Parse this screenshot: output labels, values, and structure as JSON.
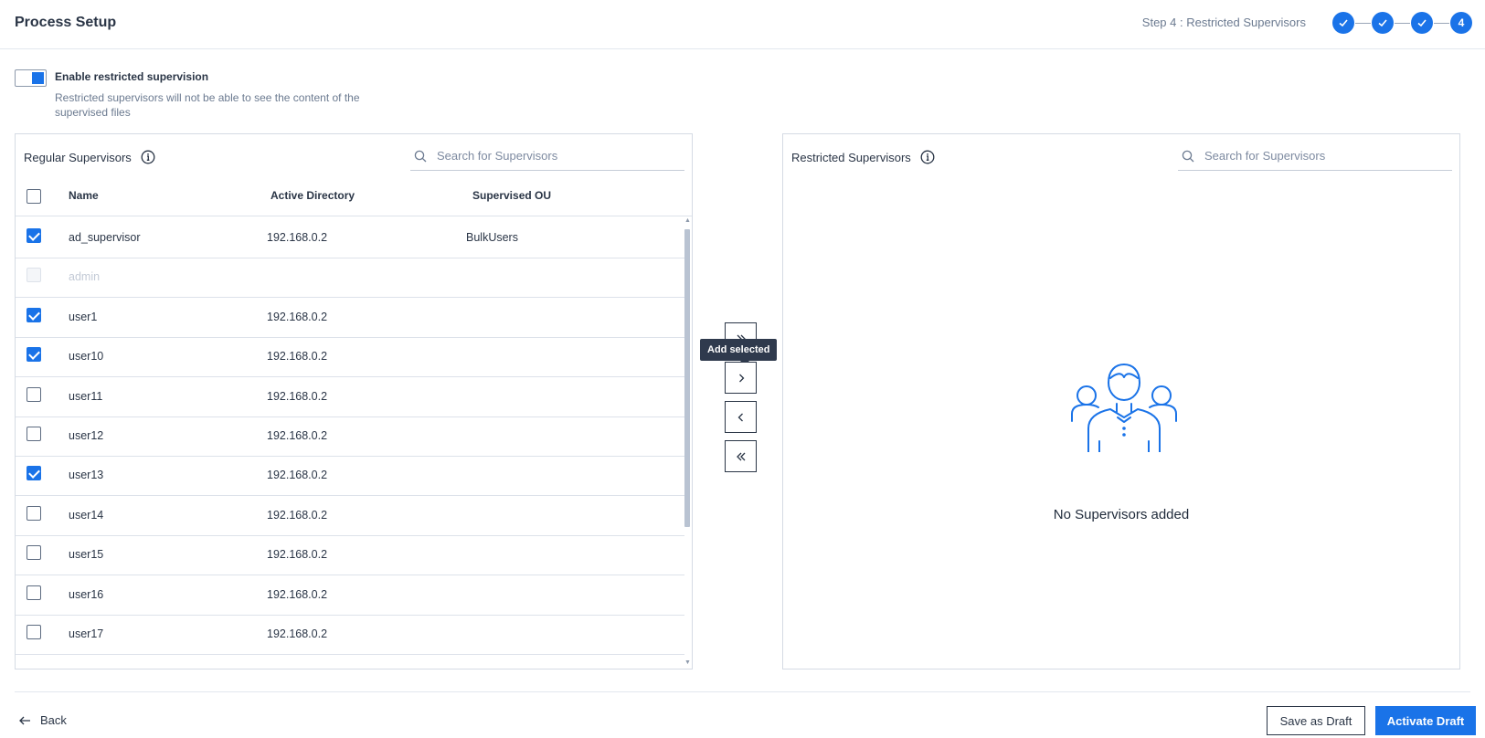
{
  "header": {
    "title": "Process Setup",
    "step_label": "Step 4 : Restricted Supervisors",
    "steps": [
      {
        "state": "done",
        "label": ""
      },
      {
        "state": "done",
        "label": ""
      },
      {
        "state": "done",
        "label": ""
      },
      {
        "state": "current",
        "label": "4"
      }
    ]
  },
  "restriction": {
    "enabled": true,
    "title": "Enable restricted supervision",
    "description": "Restricted supervisors will not be able to see the content of the supervised files"
  },
  "regular_panel": {
    "title": "Regular Supervisors",
    "search_placeholder": "Search for Supervisors",
    "columns": [
      "Name",
      "Active Directory",
      "Supervised OU"
    ],
    "select_all_checked": false,
    "rows": [
      {
        "name": "ad_supervisor",
        "directory": "192.168.0.2",
        "ou": "BulkUsers",
        "checked": true,
        "disabled": false
      },
      {
        "name": "admin",
        "directory": "",
        "ou": "",
        "checked": false,
        "disabled": true
      },
      {
        "name": "user1",
        "directory": "192.168.0.2",
        "ou": "",
        "checked": true,
        "disabled": false
      },
      {
        "name": "user10",
        "directory": "192.168.0.2",
        "ou": "",
        "checked": true,
        "disabled": false
      },
      {
        "name": "user11",
        "directory": "192.168.0.2",
        "ou": "",
        "checked": false,
        "disabled": false
      },
      {
        "name": "user12",
        "directory": "192.168.0.2",
        "ou": "",
        "checked": false,
        "disabled": false
      },
      {
        "name": "user13",
        "directory": "192.168.0.2",
        "ou": "",
        "checked": true,
        "disabled": false
      },
      {
        "name": "user14",
        "directory": "192.168.0.2",
        "ou": "",
        "checked": false,
        "disabled": false
      },
      {
        "name": "user15",
        "directory": "192.168.0.2",
        "ou": "",
        "checked": false,
        "disabled": false
      },
      {
        "name": "user16",
        "directory": "192.168.0.2",
        "ou": "",
        "checked": false,
        "disabled": false
      },
      {
        "name": "user17",
        "directory": "192.168.0.2",
        "ou": "",
        "checked": false,
        "disabled": false
      }
    ]
  },
  "transfer": {
    "tooltip": "Add selected",
    "buttons": [
      {
        "name": "add-all-button",
        "icon": "double-chevron-right-icon"
      },
      {
        "name": "add-selected-button",
        "icon": "chevron-right-icon"
      },
      {
        "name": "remove-selected-button",
        "icon": "chevron-left-icon"
      },
      {
        "name": "remove-all-button",
        "icon": "double-chevron-left-icon"
      }
    ]
  },
  "restricted_panel": {
    "title": "Restricted Supervisors",
    "search_placeholder": "Search for Supervisors",
    "empty_text": "No Supervisors added",
    "empty_icon": "users-group-icon"
  },
  "footer": {
    "back_label": "Back",
    "save_draft_label": "Save as Draft",
    "activate_label": "Activate Draft"
  },
  "colors": {
    "accent": "#1a73e8",
    "text": "#2a3546",
    "muted": "#6b7a90",
    "border": "#d5dbe4"
  }
}
